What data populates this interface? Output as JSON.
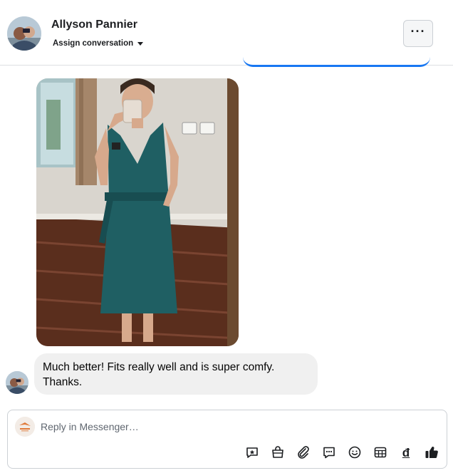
{
  "header": {
    "contact_name": "Allyson Pannier",
    "assign_label": "Assign conversation",
    "more_label": "···"
  },
  "conversation": {
    "messages": [
      {
        "type": "image",
        "description_icon": "photo-attachment"
      },
      {
        "type": "text",
        "text_line1": "Much better! Fits really well and is super comfy.",
        "text_line2": "Thanks."
      }
    ]
  },
  "composer": {
    "placeholder": "Reply in Messenger…",
    "tools": [
      "star-chat-icon",
      "shopping-bag-icon",
      "paperclip-icon",
      "saved-reply-icon",
      "emoji-icon",
      "calendar-icon",
      "currency-icon",
      "like-icon"
    ],
    "currency_glyph": "đ"
  },
  "colors": {
    "accent": "#1877f2",
    "bubble": "#f0f0f0",
    "dress": "#1f5f63"
  }
}
